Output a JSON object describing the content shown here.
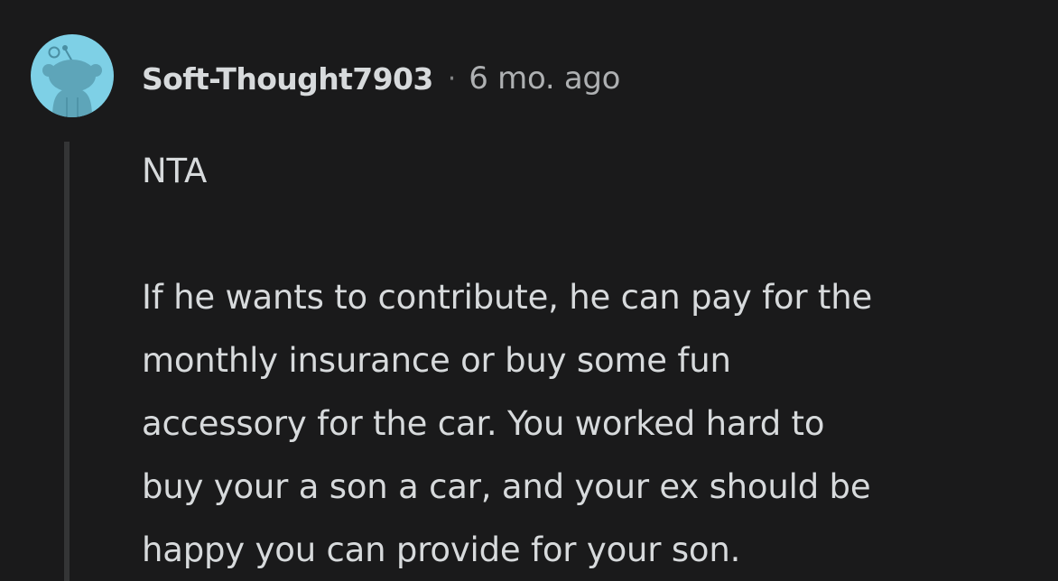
{
  "comment": {
    "author": "Soft-Thought7903",
    "separator": "·",
    "timestamp": "6 mo. ago",
    "avatar_icon": "snoo-avatar-icon",
    "colors": {
      "background": "#1a1a1b",
      "avatar_bg": "#7ed0e6",
      "text": "#d7dadc",
      "meta_text": "#aeb0b2",
      "thread_line": "#343536"
    },
    "body": {
      "paragraph_1": "NTA",
      "paragraph_2_lines": [
        "If he wants to contribute, he can pay for the",
        "monthly insurance or buy some fun",
        "accessory for the car. You worked hard to",
        "buy your a son a car, and your ex should be",
        "happy you can provide for your son."
      ]
    }
  }
}
